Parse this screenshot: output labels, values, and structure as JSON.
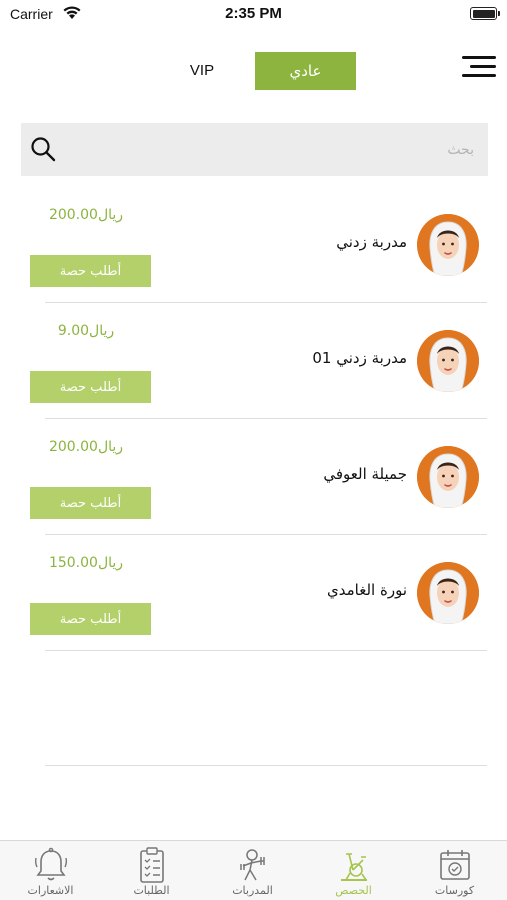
{
  "status_bar": {
    "carrier": "Carrier",
    "time": "2:35 PM"
  },
  "header": {
    "tabs": [
      {
        "label": "VIP",
        "active": false
      },
      {
        "label": "عادي",
        "active": true
      }
    ]
  },
  "search": {
    "placeholder": "بحث",
    "value": ""
  },
  "trainers": [
    {
      "name": "مدربة زدني",
      "price": "200.00ريال",
      "button": "أطلب حصة"
    },
    {
      "name": "مدربة زدني 01",
      "price": "9.00ريال",
      "button": "أطلب حصة"
    },
    {
      "name": "جميلة العوفي",
      "price": "200.00ريال",
      "button": "أطلب حصة"
    },
    {
      "name": "نورة الغامدي",
      "price": "150.00ريال",
      "button": "أطلب حصة"
    }
  ],
  "tab_bar": {
    "items": [
      {
        "label": "الاشعارات",
        "icon": "bell-icon",
        "active": false
      },
      {
        "label": "الطلبات",
        "icon": "clipboard-icon",
        "active": false
      },
      {
        "label": "المدربات",
        "icon": "trainer-icon",
        "active": false
      },
      {
        "label": "الحصص",
        "icon": "exercise-bike-icon",
        "active": true
      },
      {
        "label": "كورسات",
        "icon": "calendar-check-icon",
        "active": false
      }
    ]
  },
  "colors": {
    "accent": "#8cb43f",
    "button": "#b4d06a",
    "avatar_bg": "#e0761f"
  }
}
